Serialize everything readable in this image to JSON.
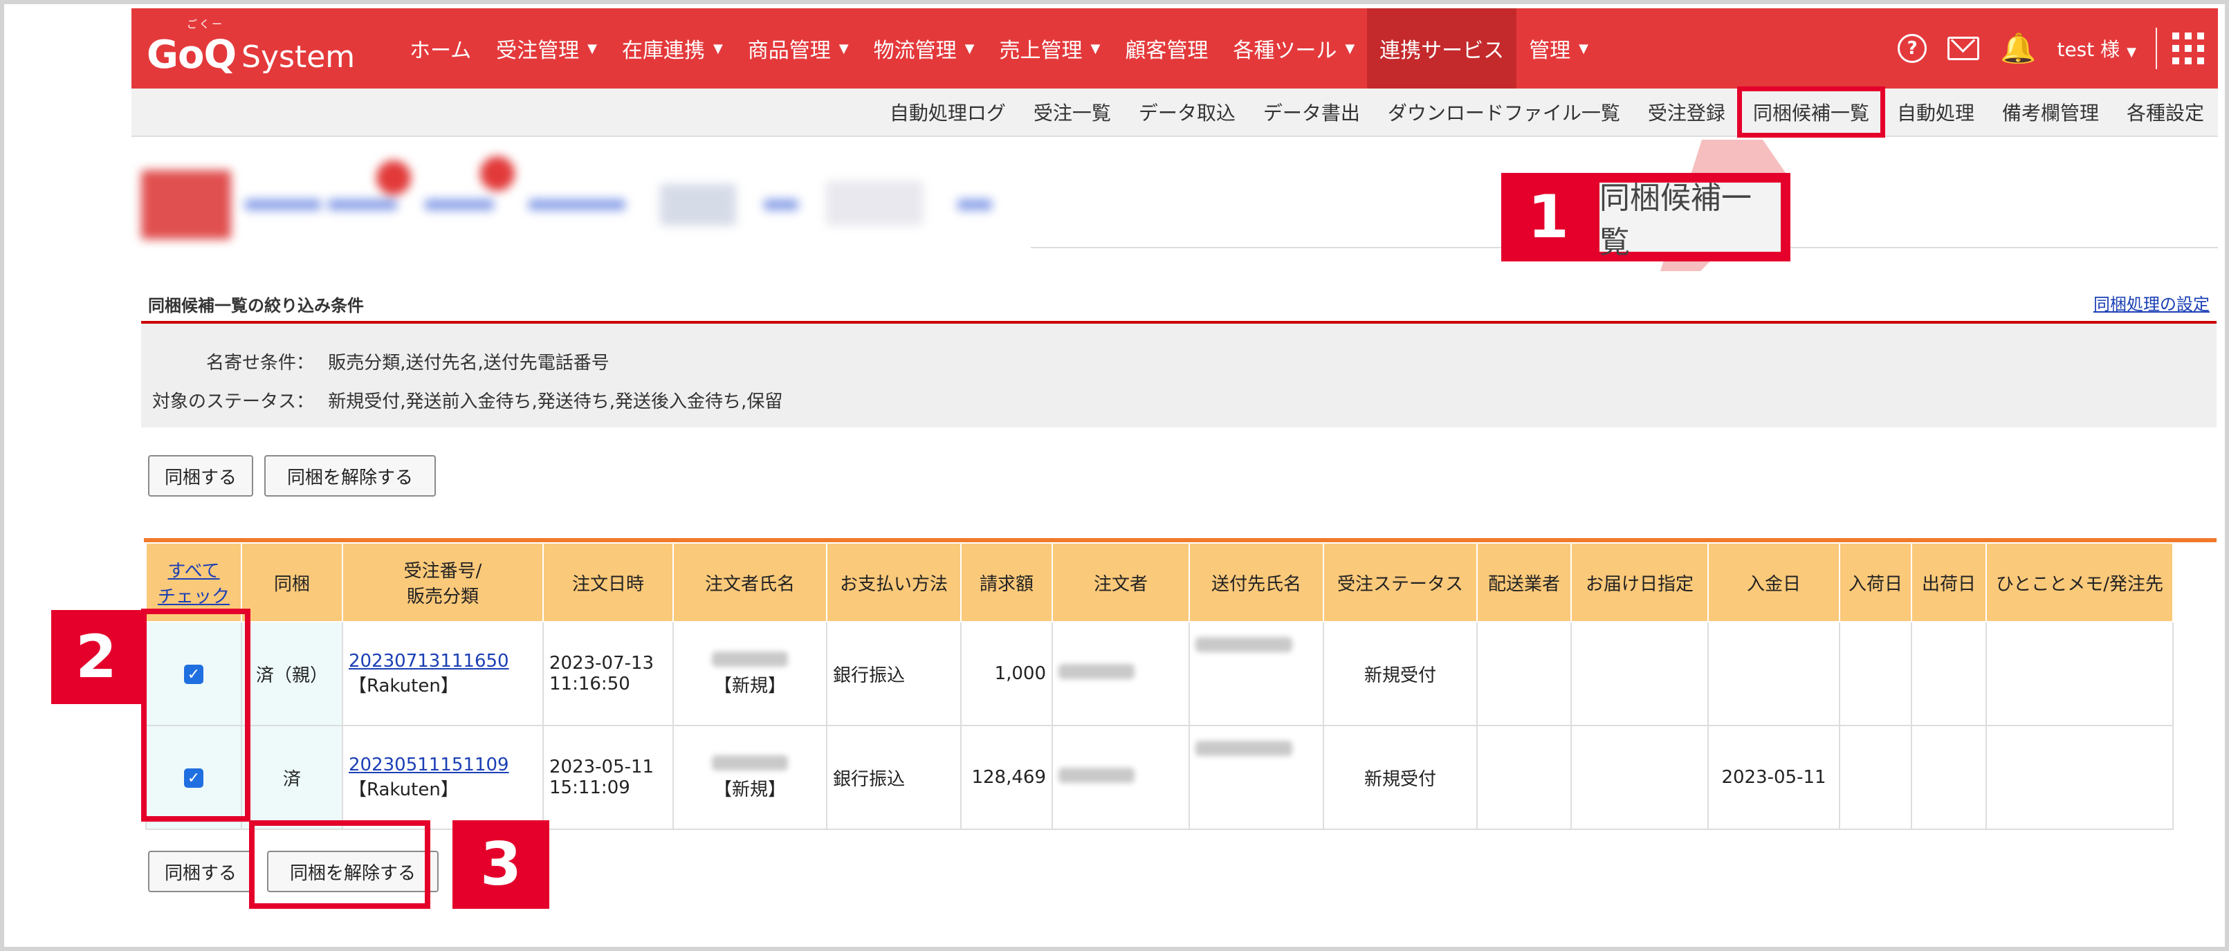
{
  "logo": {
    "main": "GoQ",
    "sub": "System",
    "ruby": "ごくー"
  },
  "nav": {
    "items": [
      {
        "label": "ホーム",
        "caret": ""
      },
      {
        "label": "受注管理",
        "caret": "▼"
      },
      {
        "label": "在庫連携",
        "caret": "▼"
      },
      {
        "label": "商品管理",
        "caret": "▼"
      },
      {
        "label": "物流管理",
        "caret": "▼"
      },
      {
        "label": "売上管理",
        "caret": "▼"
      },
      {
        "label": "顧客管理",
        "caret": ""
      },
      {
        "label": "各種ツール",
        "caret": "▼"
      },
      {
        "label": "連携サービス",
        "caret": ""
      },
      {
        "label": "管理",
        "caret": "▼"
      }
    ],
    "help_icon": "?",
    "bell_icon": "🔔",
    "user": "test 様",
    "user_caret": "▼"
  },
  "subnav": {
    "items": [
      "自動処理ログ",
      "受注一覧",
      "データ取込",
      "データ書出",
      "ダウンロードファイル一覧",
      "受注登録",
      "同梱候補一覧",
      "自動処理",
      "備考欄管理",
      "各種設定"
    ]
  },
  "callouts": {
    "num1": "1",
    "label1": "同梱候補一覧",
    "num2": "2",
    "num3": "3"
  },
  "filter": {
    "title": "同梱候補一覧の絞り込み条件",
    "settings_link": "同梱処理の設定",
    "name_label": "名寄せ条件：",
    "name_value": "販売分類,送付先名,送付先電話番号",
    "status_label": "対象のステータス：",
    "status_value": "新規受付,発送前入金待ち,発送待ち,発送後入金待ち,保留"
  },
  "buttons": {
    "bundle": "同梱する",
    "unbundle": "同梱を解除する"
  },
  "table": {
    "check_all_1": "すべて",
    "check_all_2": "チェック",
    "headers": [
      "同梱",
      "受注番号/\n販売分類",
      "注文日時",
      "注文者氏名",
      "お支払い方法",
      "請求額",
      "注文者",
      "送付先氏名",
      "受注ステータス",
      "配送業者",
      "お届け日指定",
      "入金日",
      "入荷日",
      "出荷日",
      "ひとことメモ/発注先"
    ],
    "rows": [
      {
        "checked": "✓",
        "bundle": "済（親）",
        "order_no": "20230713111650",
        "channel": "【Rakuten】",
        "date": "2023-07-13",
        "time": "11:16:50",
        "customer_tag": "【新規】",
        "payment": "銀行振込",
        "amount": "1,000",
        "status": "新規受付",
        "carrier": "",
        "delivery": "",
        "paid": "",
        "arrived": "",
        "shipped": "",
        "memo": ""
      },
      {
        "checked": "✓",
        "bundle": "済",
        "order_no": "20230511151109",
        "channel": "【Rakuten】",
        "date": "2023-05-11",
        "time": "15:11:09",
        "customer_tag": "【新規】",
        "payment": "銀行振込",
        "amount": "128,469",
        "status": "新規受付",
        "carrier": "",
        "delivery": "",
        "paid": "2023-05-11",
        "arrived": "",
        "shipped": "",
        "memo": ""
      }
    ]
  },
  "colors": {
    "brand_red": "#e4393b",
    "highlight": "#e4002b",
    "table_header": "#fbc97a",
    "accent_orange": "#f07a2a"
  }
}
